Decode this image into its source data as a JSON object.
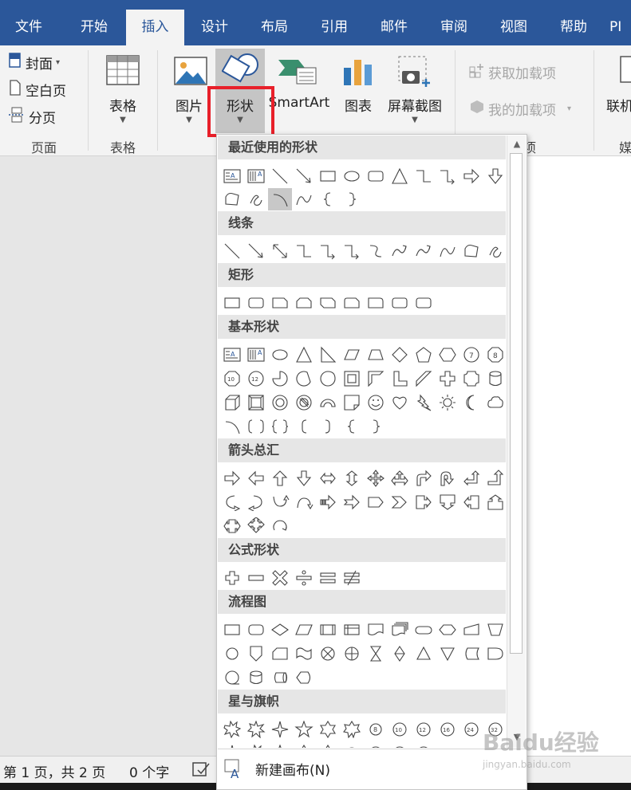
{
  "ribbon_tabs": [
    "文件",
    "开始",
    "插入",
    "设计",
    "布局",
    "引用",
    "邮件",
    "审阅",
    "视图",
    "帮助",
    "PI"
  ],
  "pages_group": {
    "cover": "封面",
    "blank_page": "空白页",
    "page_break": "分页",
    "label": "页面"
  },
  "table_group": {
    "button": "表格",
    "label": "表格"
  },
  "illustrations": {
    "picture": "图片",
    "shapes": "形状",
    "smartart": "SmartArt",
    "chart": "图表",
    "screenshot": "屏幕截图"
  },
  "addins": {
    "get_addins": "获取加载项",
    "my_addins": "我的加载项"
  },
  "partial_group_label": "加项",
  "online_video": "联机",
  "media_label": "媒",
  "shape_gallery": {
    "categories": [
      "最近使用的形状",
      "线条",
      "矩形",
      "基本形状",
      "箭头总汇",
      "公式形状",
      "流程图",
      "星与旗帜"
    ],
    "footer_label": "新建画布(N)"
  },
  "status_bar": {
    "page_info": "第 1 页，共 2 页",
    "word_count": "0 个字"
  },
  "watermark": {
    "brand": "Baidu经验",
    "url": "jingyan.baidu.com"
  },
  "colors": {
    "tab_blue": "#2b579a",
    "highlight_red": "#e8202a",
    "ribbon_bg": "#f3f3f3"
  }
}
